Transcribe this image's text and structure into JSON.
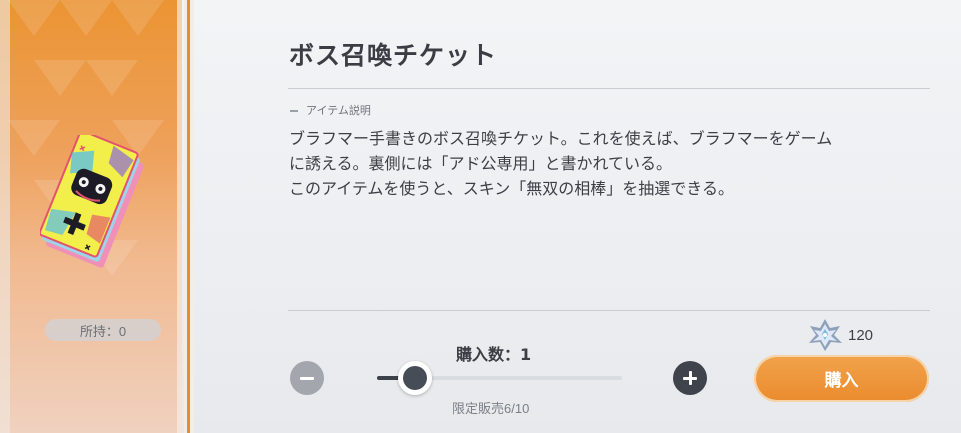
{
  "item": {
    "title": "ボス召喚チケット",
    "owned_label": "所持：0",
    "section_label": "アイテム説明",
    "description_lines": [
      "ブラフマー手書きのボス召喚チケット。これを使えば、ブラフマーをゲーム",
      "に誘える。裏側には「アド公専用」と書かれている。",
      "このアイテムを使うと、スキン「無双の相棒」を抽選できる。"
    ]
  },
  "purchase": {
    "quantity_label": "購入数：1",
    "quantity": 1,
    "max_quantity": 10,
    "slider_fraction": 0.1,
    "limit_label": "限定販売6/10",
    "price": "120",
    "currency_icon": "crystal-gem-icon",
    "buy_label": "購入"
  },
  "colors": {
    "accent": "#ea8b2d",
    "panel_top": "#eb9433",
    "text": "#3a3d44"
  }
}
